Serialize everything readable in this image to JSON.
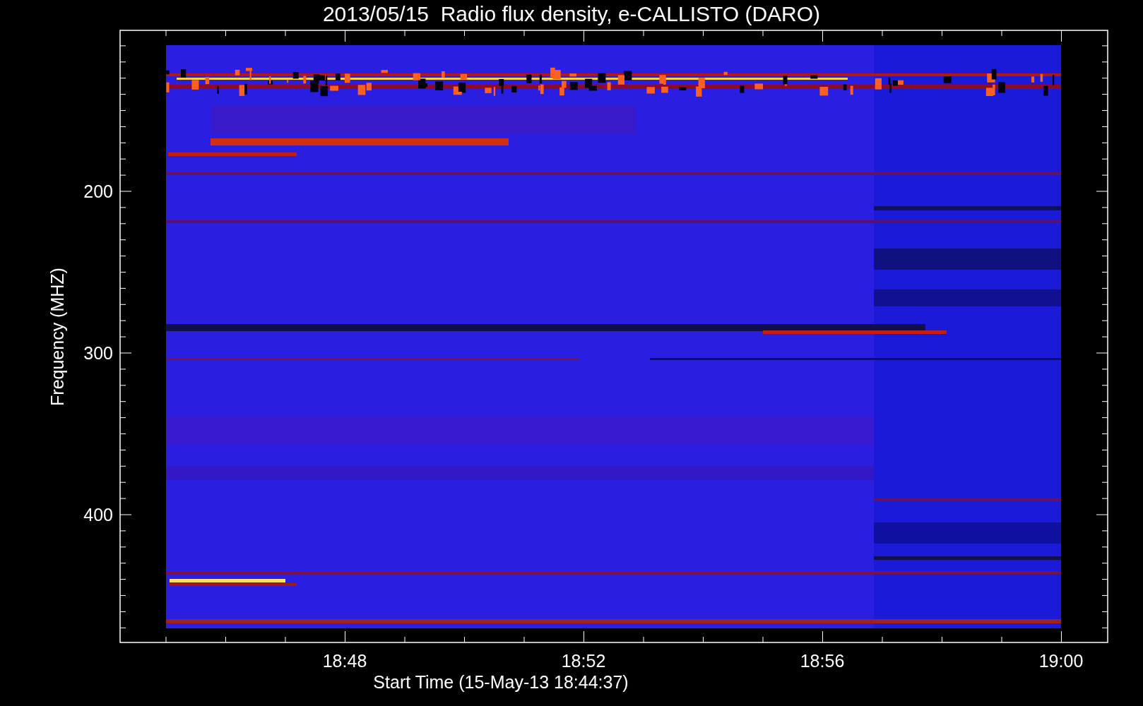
{
  "title": "2013/05/15  Radio flux density, e-CALLISTO (DARO)",
  "y_axis": {
    "label": "Frequency (MHZ)",
    "ticks": [
      "200",
      "300",
      "400"
    ]
  },
  "x_axis": {
    "label": "Start Time (15-May-13 18:44:37)",
    "ticks": [
      "18:48",
      "18:52",
      "18:56",
      "19:00"
    ]
  }
}
